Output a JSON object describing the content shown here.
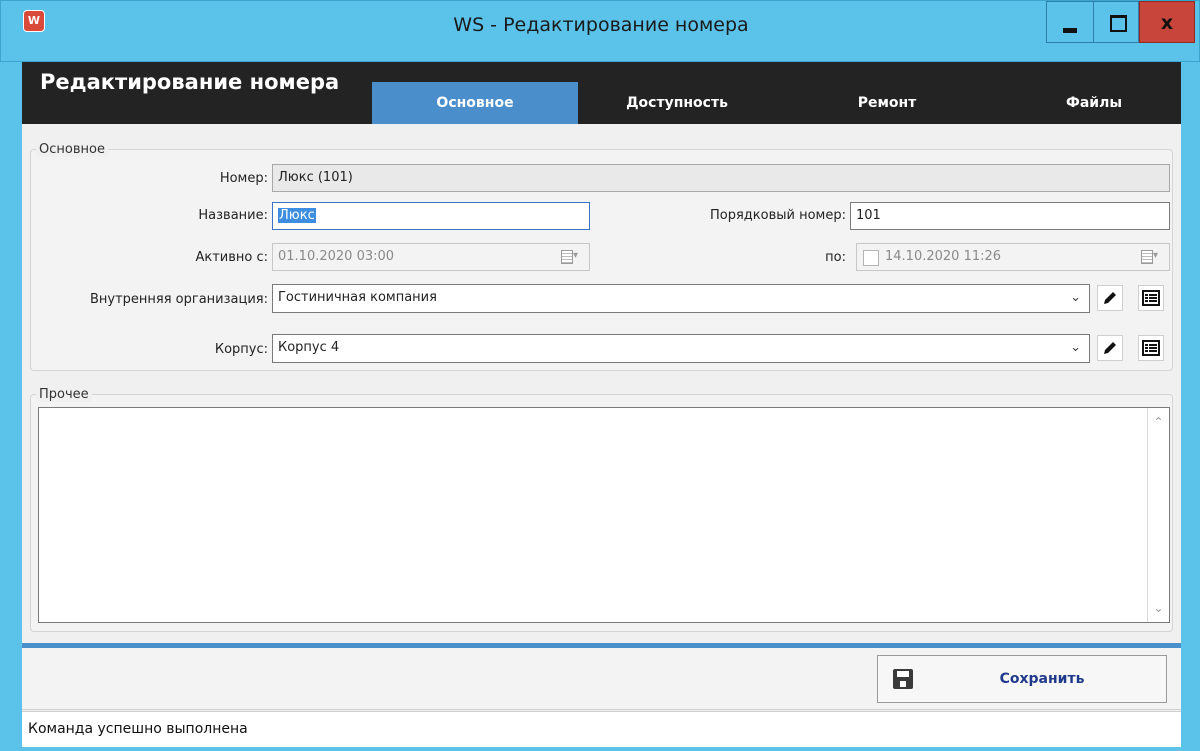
{
  "window": {
    "title": "WS - Редактирование номера",
    "app_icon_letter": "W",
    "close_glyph": "x",
    "frame_color": "#5bc3ea"
  },
  "header": {
    "title": "Редактирование номера",
    "tabs": [
      {
        "label": "Основное",
        "active": true
      },
      {
        "label": "Доступность",
        "active": false
      },
      {
        "label": "Ремонт",
        "active": false
      },
      {
        "label": "Файлы",
        "active": false
      }
    ],
    "active_tab_color": "#4a8fcb"
  },
  "main_group": {
    "label": "Основное",
    "number": {
      "label": "Номер:",
      "value": "Люкс (101)"
    },
    "name": {
      "label": "Название:",
      "value": "Люкс"
    },
    "order_number": {
      "label": "Порядковый номер:",
      "value": "101"
    },
    "active_from": {
      "label": "Активно с:",
      "value": "01.10.2020 03:00"
    },
    "active_to": {
      "label": "по:",
      "value": "14.10.2020 11:26",
      "checked": false
    },
    "organization": {
      "label": "Внутренняя организация:",
      "value": "Гостиничная компания"
    },
    "building": {
      "label": "Корпус:",
      "value": "Корпус 4"
    }
  },
  "other_group": {
    "label": "Прочее",
    "memo_value": ""
  },
  "icons": {
    "calendar": "calendar-icon",
    "dropdown": "chevron-down-icon",
    "edit": "pencil-icon",
    "list": "list-icon",
    "save": "floppy-disk-icon"
  },
  "footer": {
    "save_label": "Сохранить",
    "status_text": "Команда успешно выполнена"
  }
}
